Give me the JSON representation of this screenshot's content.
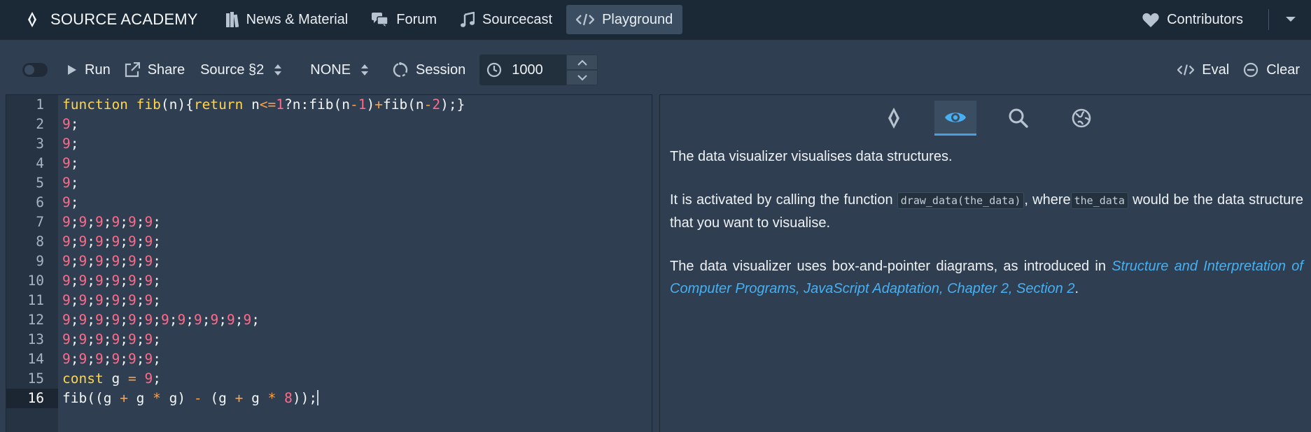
{
  "topbar": {
    "brand": "SOURCE ACADEMY",
    "nav": [
      {
        "label": "News & Material",
        "icon": "book-icon"
      },
      {
        "label": "Forum",
        "icon": "chat-icon"
      },
      {
        "label": "Sourcecast",
        "icon": "music-icon"
      },
      {
        "label": "Playground",
        "icon": "code-icon"
      }
    ],
    "contributors": "Contributors"
  },
  "toolbar": {
    "run": "Run",
    "share": "Share",
    "language": "Source §2",
    "variant": "NONE",
    "session": "Session",
    "timeout": "1000",
    "eval": "Eval",
    "clear": "Clear"
  },
  "editor": {
    "current_line": 16,
    "line_numbers": [
      "1",
      "2",
      "3",
      "4",
      "5",
      "6",
      "7",
      "8",
      "9",
      "10",
      "11",
      "12",
      "13",
      "14",
      "15",
      "16"
    ]
  },
  "side_panel": {
    "tabs": [
      "env-visualizer-icon",
      "data-visualizer-icon",
      "inspector-icon",
      "globe-icon"
    ],
    "active_tab": 1,
    "para1": "The data visualizer visualises data structures.",
    "para2_a": "It is activated by calling the function ",
    "para2_code1": "draw_data(the_data)",
    "para2_b": ", where",
    "para2_code2": "the_data",
    "para2_c": " would be the data structure that you want to visualise.",
    "para3_a": "The data visualizer uses box-and-pointer diagrams, as introduced in ",
    "para3_link": "Structure and Interpretation of Computer Programs, JavaScript Adaptation, Chapter 2, Section 2",
    "para3_b": "."
  },
  "colors": {
    "topbar_bg": "#1b2836",
    "page_bg": "#2f3f51",
    "active_nav": "#3b4d61",
    "keyword": "#fdd54f",
    "number": "#ff6b8b",
    "operator": "#ff9f43",
    "link": "#48aff0"
  }
}
